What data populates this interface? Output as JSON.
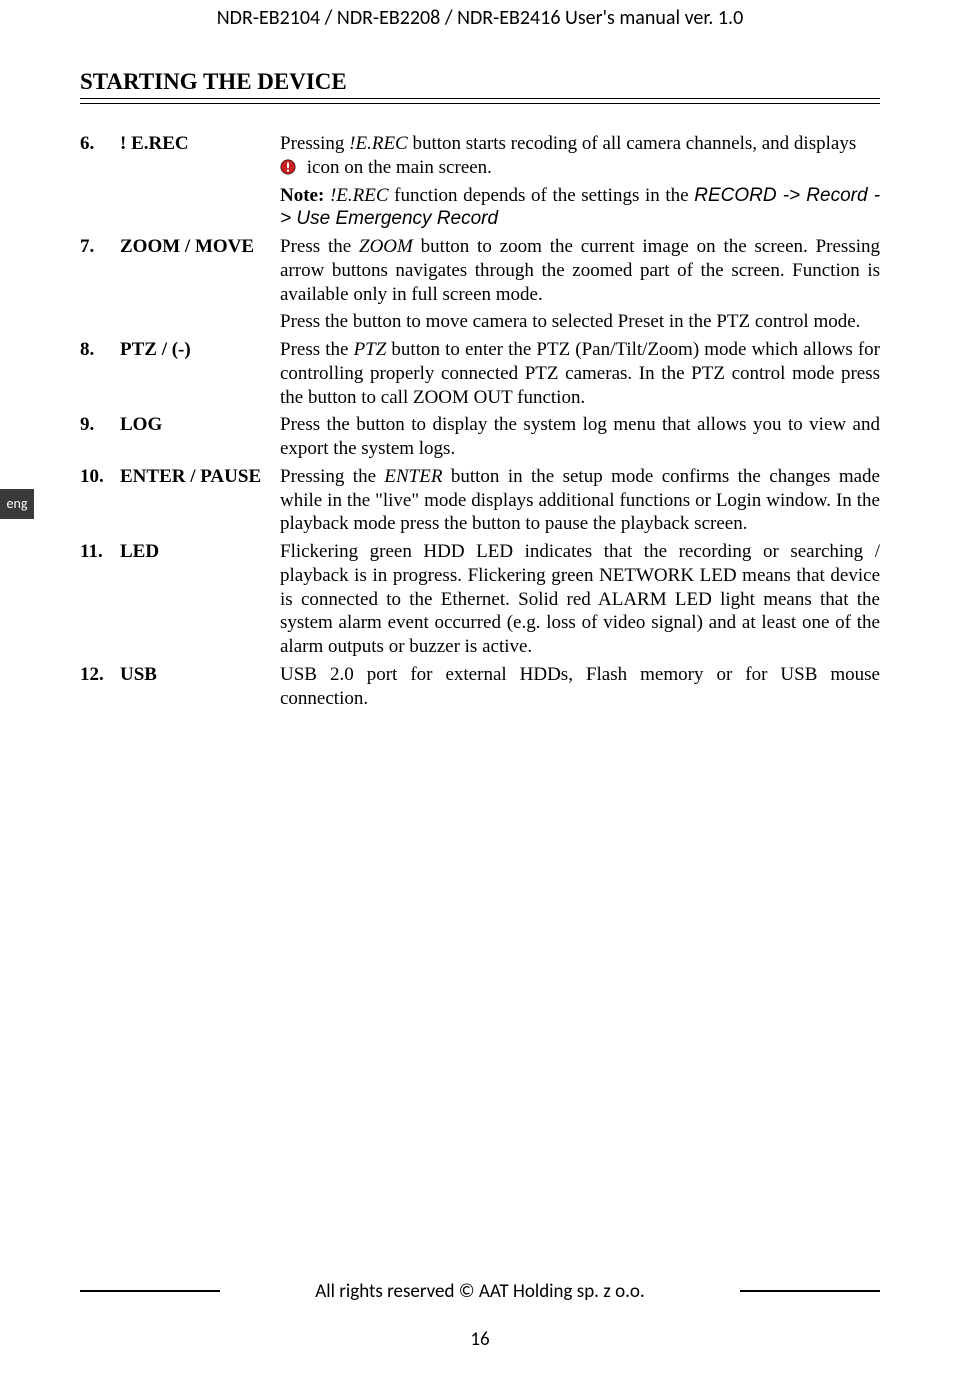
{
  "header": {
    "title": "NDR-EB2104 / NDR-EB2208 / NDR-EB2416 User's manual ver. 1.0"
  },
  "lang_tab": "eng",
  "section_heading": "STARTING THE DEVICE",
  "items": {
    "i6": {
      "num": "6.",
      "label": "! E.REC",
      "p1a": "Pressing ",
      "p1b": "!E.REC",
      "p1c": " button starts recoding of all camera channels, and displays",
      "p1d": " icon on the main screen.",
      "note_label": "Note:",
      "note_a": "  ",
      "note_b": "!E.REC",
      "note_c": "  function  depends  of  the  settings  in  the  ",
      "note_d": "RECORD  -> Record - > Use Emergency Record"
    },
    "i7": {
      "num": "7.",
      "label": "ZOOM / MOVE",
      "p1a": "Press the ",
      "p1b": "ZOOM",
      "p1c": " button to zoom the current image on the screen. Pressing arrow buttons navigates through the zoomed part of the screen. Function is available only in full screen mode.",
      "p2": "Press  the  button  to  move  camera  to  selected  Preset  in  the  PTZ  control mode."
    },
    "i8": {
      "num": "8.",
      "label": "PTZ / (-)",
      "p1a": "Press the ",
      "p1b": "PTZ",
      "p1c": " button to enter the PTZ (Pan/Tilt/Zoom) mode which allows for controlling properly connected PTZ cameras. In the PTZ control mode press the button to call ZOOM OUT function."
    },
    "i9": {
      "num": "9.",
      "label": "LOG",
      "p1": "Press the button to display the system log menu that allows you to view and export the system logs."
    },
    "i10": {
      "num": "10.",
      "label": "ENTER / PAUSE",
      "p1a": "Pressing the ",
      "p1b": "ENTER",
      "p1c": " button in the setup mode confirms the changes made while  in  the  \"live\"  mode  displays  additional  functions  or  Login  window.  In the playback mode press the button to pause the playback screen."
    },
    "i11": {
      "num": "11.",
      "label": "LED",
      "p1": "Flickering  green  HDD  LED  indicates  that  the  recording  or  searching  / playback  is  in  progress.  Flickering  green  NETWORK  LED  means  that device  is  connected  to  the  Ethernet.  Solid  red  ALARM  LED  light  means that  the  system  alarm  event  occurred  (e.g.  loss  of  video  signal)  and  at least one of the alarm outputs or buzzer is active."
    },
    "i12": {
      "num": "12.",
      "label": "USB",
      "p1": "USB  2.0  port  for  external  HDDs,  Flash  memory  or  for  USB  mouse connection."
    }
  },
  "footer": {
    "text": "All rights reserved © AAT Holding sp. z o.o.",
    "page": "16"
  },
  "icons": {
    "alert": "alert-icon"
  }
}
